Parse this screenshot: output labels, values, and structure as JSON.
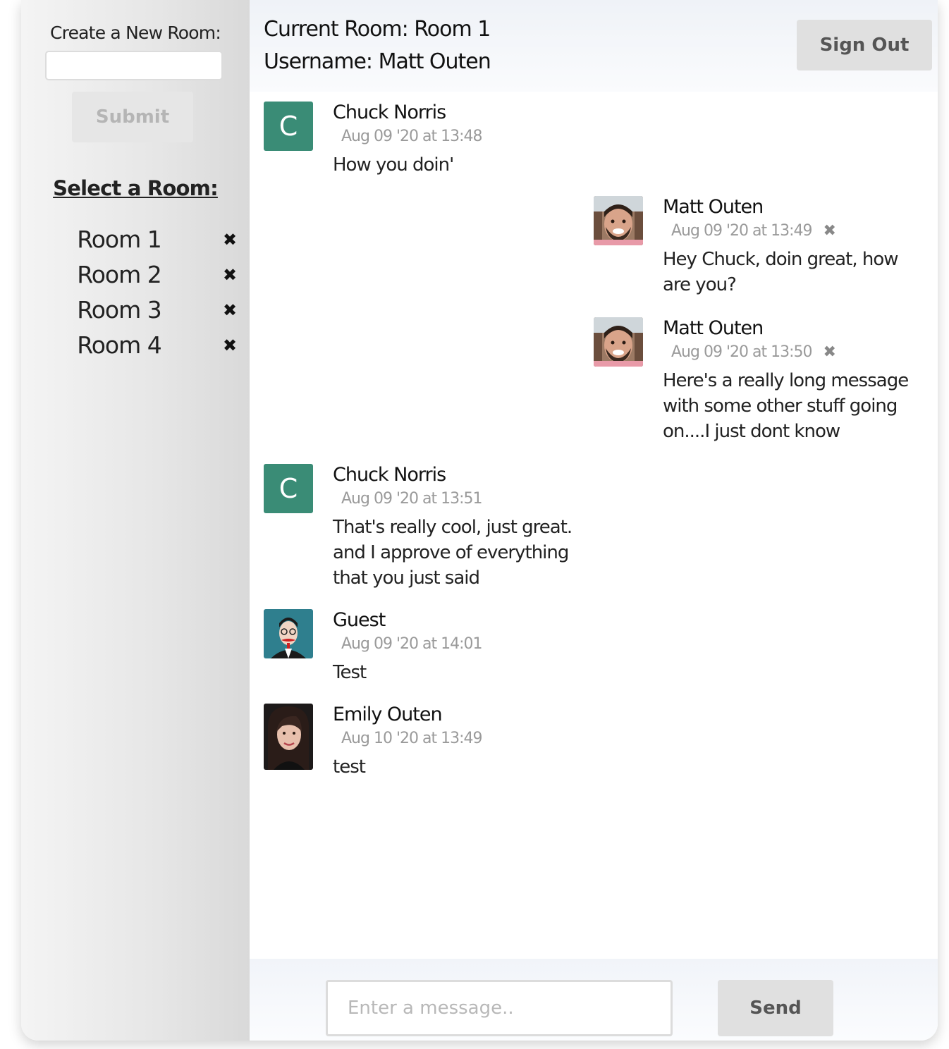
{
  "sidebar": {
    "create_label": "Create a New Room:",
    "room_input_value": "",
    "submit_label": "Submit",
    "select_heading": "Select a Room:",
    "rooms": [
      {
        "name": "Room 1",
        "delete_icon": "✖"
      },
      {
        "name": "Room 2",
        "delete_icon": "✖"
      },
      {
        "name": "Room 3",
        "delete_icon": "✖"
      },
      {
        "name": "Room 4",
        "delete_icon": "✖"
      }
    ]
  },
  "header": {
    "current_room": "Current Room: Room 1",
    "username": "Username: Matt Outen",
    "signout_label": "Sign Out"
  },
  "messages": [
    {
      "name": "Chuck Norris",
      "time": "Aug 09 '20 at 13:48",
      "text": "How you doin'",
      "avatar_letter": "C",
      "avatar_color": "#3a8c76",
      "own": false,
      "deletable": false
    },
    {
      "name": "Matt Outen",
      "time": "Aug 09 '20 at 13:49",
      "text": "Hey Chuck, doin great, how are you?",
      "avatar": "photo-man",
      "own": true,
      "deletable": true,
      "delete_icon": "✖"
    },
    {
      "name": "Matt Outen",
      "time": "Aug 09 '20 at 13:50",
      "text": "Here's a really long message with some other stuff going on....I just dont know",
      "avatar": "photo-man",
      "own": true,
      "deletable": true,
      "delete_icon": "✖"
    },
    {
      "name": "Chuck Norris",
      "time": "Aug 09 '20 at 13:51",
      "text": "That's really cool, just great. and I approve of everything that you just said",
      "avatar_letter": "C",
      "avatar_color": "#3a8c76",
      "own": false,
      "deletable": false
    },
    {
      "name": "Guest",
      "time": "Aug 09 '20 at 14:01",
      "text": "Test",
      "avatar": "cartoon-guest",
      "own": false,
      "deletable": false
    },
    {
      "name": "Emily Outen",
      "time": "Aug 10 '20 at 13:49",
      "text": "test",
      "avatar": "photo-woman",
      "own": false,
      "deletable": false
    }
  ],
  "composer": {
    "placeholder": "Enter a message..",
    "value": "",
    "send_label": "Send"
  }
}
